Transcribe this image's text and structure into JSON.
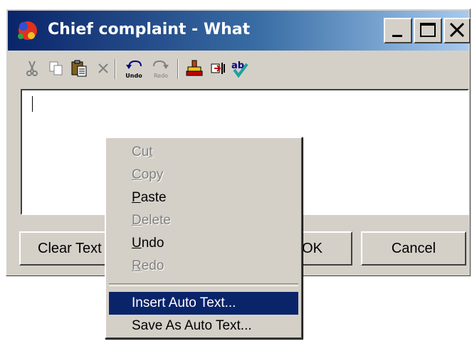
{
  "window": {
    "title": "Chief complaint - What"
  },
  "titlebar_buttons": {
    "minimize": "_",
    "maximize": "□",
    "close": "✕"
  },
  "toolbar": {
    "items": [
      {
        "name": "cut-icon"
      },
      {
        "name": "copy-icon"
      },
      {
        "name": "paste-icon"
      },
      {
        "name": "delete-icon"
      },
      {
        "name": "undo-icon",
        "label": "Undo"
      },
      {
        "name": "redo-icon",
        "label": "Redo"
      },
      {
        "name": "stamp-icon"
      },
      {
        "name": "insert-field-icon"
      },
      {
        "name": "spellcheck-icon"
      }
    ]
  },
  "editor": {
    "value": ""
  },
  "buttons": {
    "clear": "Clear Text",
    "ok": "OK",
    "cancel": "Cancel"
  },
  "context_menu": {
    "items": [
      {
        "label": "Cut",
        "underline": "t",
        "disabled": true
      },
      {
        "label": "Copy",
        "underline": "C",
        "disabled": true
      },
      {
        "label": "Paste",
        "underline": "P",
        "disabled": false
      },
      {
        "label": "Delete",
        "underline": "D",
        "disabled": true
      },
      {
        "label": "Undo",
        "underline": "U",
        "disabled": false
      },
      {
        "label": "Redo",
        "underline": "R",
        "disabled": true
      },
      {
        "label": "Insert Auto Text...",
        "disabled": false,
        "selected": true
      },
      {
        "label": "Save As Auto Text...",
        "disabled": false
      }
    ]
  },
  "colors": {
    "selection": "#0a246a",
    "face": "#d4d0c8",
    "title_start": "#0a246a",
    "title_end": "#a6caf0"
  }
}
